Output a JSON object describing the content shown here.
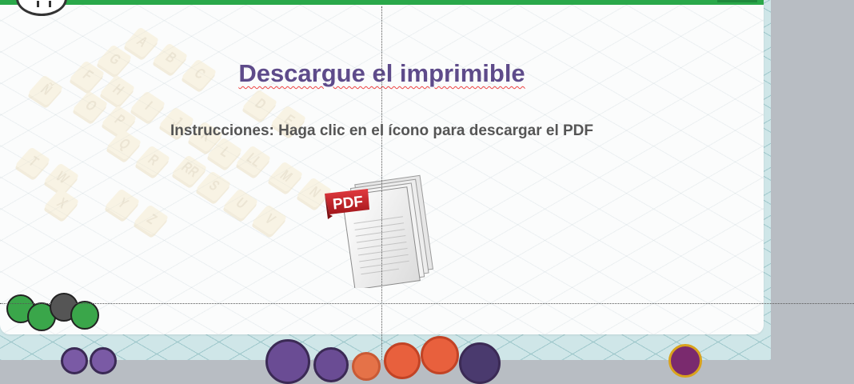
{
  "page": {
    "title": "Descargue el imprimible",
    "instructions": "Instrucciones: Haga clic en el ícono para descargar el PDF"
  },
  "download": {
    "icon": "pdf-document-icon",
    "badge_text": "PDF"
  },
  "background_tiles": [
    "A",
    "B",
    "C",
    "G",
    "H",
    "I",
    "J",
    "K",
    "Ñ",
    "O",
    "P",
    "Q",
    "R",
    "S",
    "T",
    "U",
    "V",
    "W",
    "X",
    "Y",
    "Z",
    "LL",
    "M",
    "N",
    "RR",
    "D",
    "E",
    "F",
    "L"
  ],
  "colors": {
    "accent_green": "#2aa84a",
    "title_purple": "#5e4b8a",
    "instruction_gray": "#555555",
    "pdf_red": "#c0272d"
  }
}
